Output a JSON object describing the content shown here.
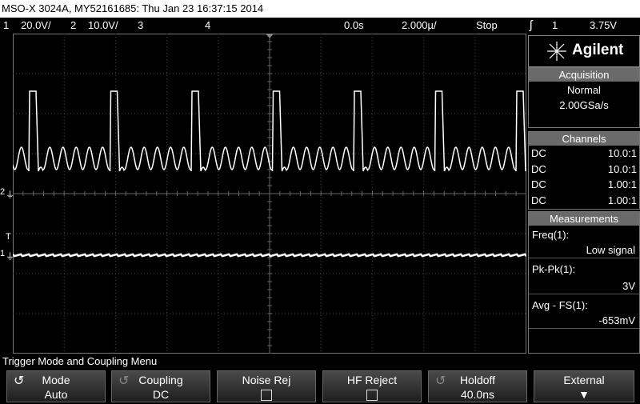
{
  "title": "MSO-X 3024A, MY52161685: Thu Jan 23 16:37:15 2014",
  "status": {
    "ch1_num": "1",
    "ch1_scale": "20.0V/",
    "ch2_num": "2",
    "ch2_scale": "10.0V/",
    "ch3_num": "3",
    "ch4_num": "4",
    "delay": "0.0s",
    "timebase": "2.000µ/",
    "run_state": "Stop",
    "trig_source": "1",
    "trig_level": "3.75V"
  },
  "brand": "Agilent",
  "acquisition": {
    "header": "Acquisition",
    "mode": "Normal",
    "rate": "2.00GSa/s"
  },
  "channels": {
    "header": "Channels",
    "rows": [
      {
        "coupling": "DC",
        "probe": "10.0:1"
      },
      {
        "coupling": "DC",
        "probe": "10.0:1"
      },
      {
        "coupling": "DC",
        "probe": "1.00:1"
      },
      {
        "coupling": "DC",
        "probe": "1.00:1"
      }
    ]
  },
  "measurements": {
    "header": "Measurements",
    "items": [
      {
        "label": "Freq(1):",
        "value": "Low signal"
      },
      {
        "label": "Pk-Pk(1):",
        "value": "3V"
      },
      {
        "label": "Avg - FS(1):",
        "value": "-653mV"
      }
    ]
  },
  "menu_title": "Trigger Mode and Coupling Menu",
  "softkeys": [
    {
      "label": "Mode",
      "value": "Auto"
    },
    {
      "label": "Coupling",
      "value": "DC"
    },
    {
      "label": "Noise Rej",
      "value": ""
    },
    {
      "label": "HF Reject",
      "value": ""
    },
    {
      "label": "Holdoff",
      "value": "40.0ns"
    },
    {
      "label": "External",
      "value": ""
    }
  ],
  "markers": {
    "ch2": "2",
    "trigger": "T",
    "ch1": "1"
  },
  "colors": {
    "trace": "#ffffff",
    "grid": "#4a4a4a",
    "header_bg": "#6a6a6a"
  }
}
